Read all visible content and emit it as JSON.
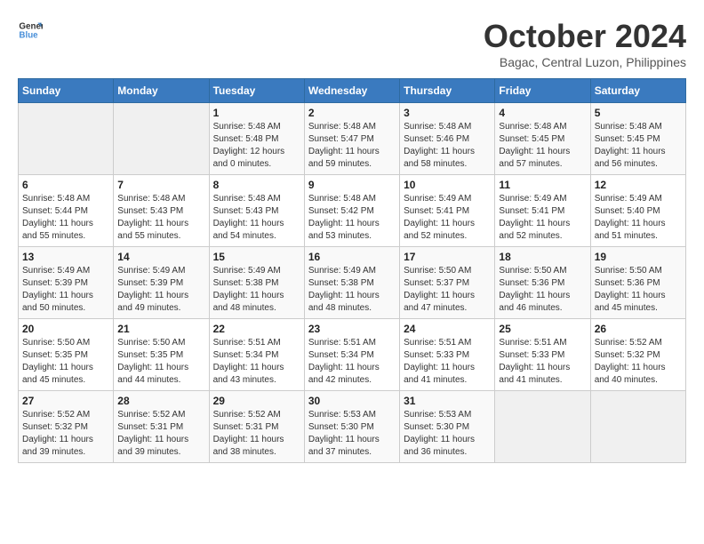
{
  "header": {
    "logo_line1": "General",
    "logo_line2": "Blue",
    "month": "October 2024",
    "location": "Bagac, Central Luzon, Philippines"
  },
  "weekdays": [
    "Sunday",
    "Monday",
    "Tuesday",
    "Wednesday",
    "Thursday",
    "Friday",
    "Saturday"
  ],
  "weeks": [
    [
      {
        "day": "",
        "sunrise": "",
        "sunset": "",
        "daylight": ""
      },
      {
        "day": "",
        "sunrise": "",
        "sunset": "",
        "daylight": ""
      },
      {
        "day": "1",
        "sunrise": "Sunrise: 5:48 AM",
        "sunset": "Sunset: 5:48 PM",
        "daylight": "Daylight: 12 hours and 0 minutes."
      },
      {
        "day": "2",
        "sunrise": "Sunrise: 5:48 AM",
        "sunset": "Sunset: 5:47 PM",
        "daylight": "Daylight: 11 hours and 59 minutes."
      },
      {
        "day": "3",
        "sunrise": "Sunrise: 5:48 AM",
        "sunset": "Sunset: 5:46 PM",
        "daylight": "Daylight: 11 hours and 58 minutes."
      },
      {
        "day": "4",
        "sunrise": "Sunrise: 5:48 AM",
        "sunset": "Sunset: 5:45 PM",
        "daylight": "Daylight: 11 hours and 57 minutes."
      },
      {
        "day": "5",
        "sunrise": "Sunrise: 5:48 AM",
        "sunset": "Sunset: 5:45 PM",
        "daylight": "Daylight: 11 hours and 56 minutes."
      }
    ],
    [
      {
        "day": "6",
        "sunrise": "Sunrise: 5:48 AM",
        "sunset": "Sunset: 5:44 PM",
        "daylight": "Daylight: 11 hours and 55 minutes."
      },
      {
        "day": "7",
        "sunrise": "Sunrise: 5:48 AM",
        "sunset": "Sunset: 5:43 PM",
        "daylight": "Daylight: 11 hours and 55 minutes."
      },
      {
        "day": "8",
        "sunrise": "Sunrise: 5:48 AM",
        "sunset": "Sunset: 5:43 PM",
        "daylight": "Daylight: 11 hours and 54 minutes."
      },
      {
        "day": "9",
        "sunrise": "Sunrise: 5:48 AM",
        "sunset": "Sunset: 5:42 PM",
        "daylight": "Daylight: 11 hours and 53 minutes."
      },
      {
        "day": "10",
        "sunrise": "Sunrise: 5:49 AM",
        "sunset": "Sunset: 5:41 PM",
        "daylight": "Daylight: 11 hours and 52 minutes."
      },
      {
        "day": "11",
        "sunrise": "Sunrise: 5:49 AM",
        "sunset": "Sunset: 5:41 PM",
        "daylight": "Daylight: 11 hours and 52 minutes."
      },
      {
        "day": "12",
        "sunrise": "Sunrise: 5:49 AM",
        "sunset": "Sunset: 5:40 PM",
        "daylight": "Daylight: 11 hours and 51 minutes."
      }
    ],
    [
      {
        "day": "13",
        "sunrise": "Sunrise: 5:49 AM",
        "sunset": "Sunset: 5:39 PM",
        "daylight": "Daylight: 11 hours and 50 minutes."
      },
      {
        "day": "14",
        "sunrise": "Sunrise: 5:49 AM",
        "sunset": "Sunset: 5:39 PM",
        "daylight": "Daylight: 11 hours and 49 minutes."
      },
      {
        "day": "15",
        "sunrise": "Sunrise: 5:49 AM",
        "sunset": "Sunset: 5:38 PM",
        "daylight": "Daylight: 11 hours and 48 minutes."
      },
      {
        "day": "16",
        "sunrise": "Sunrise: 5:49 AM",
        "sunset": "Sunset: 5:38 PM",
        "daylight": "Daylight: 11 hours and 48 minutes."
      },
      {
        "day": "17",
        "sunrise": "Sunrise: 5:50 AM",
        "sunset": "Sunset: 5:37 PM",
        "daylight": "Daylight: 11 hours and 47 minutes."
      },
      {
        "day": "18",
        "sunrise": "Sunrise: 5:50 AM",
        "sunset": "Sunset: 5:36 PM",
        "daylight": "Daylight: 11 hours and 46 minutes."
      },
      {
        "day": "19",
        "sunrise": "Sunrise: 5:50 AM",
        "sunset": "Sunset: 5:36 PM",
        "daylight": "Daylight: 11 hours and 45 minutes."
      }
    ],
    [
      {
        "day": "20",
        "sunrise": "Sunrise: 5:50 AM",
        "sunset": "Sunset: 5:35 PM",
        "daylight": "Daylight: 11 hours and 45 minutes."
      },
      {
        "day": "21",
        "sunrise": "Sunrise: 5:50 AM",
        "sunset": "Sunset: 5:35 PM",
        "daylight": "Daylight: 11 hours and 44 minutes."
      },
      {
        "day": "22",
        "sunrise": "Sunrise: 5:51 AM",
        "sunset": "Sunset: 5:34 PM",
        "daylight": "Daylight: 11 hours and 43 minutes."
      },
      {
        "day": "23",
        "sunrise": "Sunrise: 5:51 AM",
        "sunset": "Sunset: 5:34 PM",
        "daylight": "Daylight: 11 hours and 42 minutes."
      },
      {
        "day": "24",
        "sunrise": "Sunrise: 5:51 AM",
        "sunset": "Sunset: 5:33 PM",
        "daylight": "Daylight: 11 hours and 41 minutes."
      },
      {
        "day": "25",
        "sunrise": "Sunrise: 5:51 AM",
        "sunset": "Sunset: 5:33 PM",
        "daylight": "Daylight: 11 hours and 41 minutes."
      },
      {
        "day": "26",
        "sunrise": "Sunrise: 5:52 AM",
        "sunset": "Sunset: 5:32 PM",
        "daylight": "Daylight: 11 hours and 40 minutes."
      }
    ],
    [
      {
        "day": "27",
        "sunrise": "Sunrise: 5:52 AM",
        "sunset": "Sunset: 5:32 PM",
        "daylight": "Daylight: 11 hours and 39 minutes."
      },
      {
        "day": "28",
        "sunrise": "Sunrise: 5:52 AM",
        "sunset": "Sunset: 5:31 PM",
        "daylight": "Daylight: 11 hours and 39 minutes."
      },
      {
        "day": "29",
        "sunrise": "Sunrise: 5:52 AM",
        "sunset": "Sunset: 5:31 PM",
        "daylight": "Daylight: 11 hours and 38 minutes."
      },
      {
        "day": "30",
        "sunrise": "Sunrise: 5:53 AM",
        "sunset": "Sunset: 5:30 PM",
        "daylight": "Daylight: 11 hours and 37 minutes."
      },
      {
        "day": "31",
        "sunrise": "Sunrise: 5:53 AM",
        "sunset": "Sunset: 5:30 PM",
        "daylight": "Daylight: 11 hours and 36 minutes."
      },
      {
        "day": "",
        "sunrise": "",
        "sunset": "",
        "daylight": ""
      },
      {
        "day": "",
        "sunrise": "",
        "sunset": "",
        "daylight": ""
      }
    ]
  ]
}
